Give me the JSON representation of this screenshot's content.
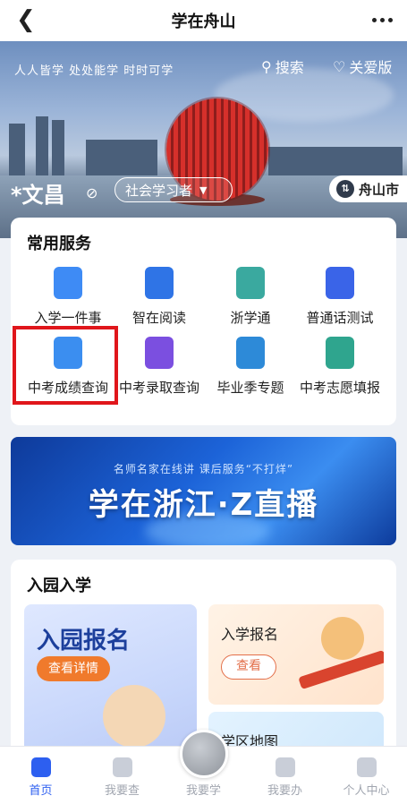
{
  "header": {
    "title": "学在舟山"
  },
  "hero": {
    "slogan": "人人皆学 处处能学 时时可学",
    "search_label": "搜索",
    "care_label": "关爱版",
    "user_name": "*文昌",
    "role": "社会学习者",
    "city": "舟山市"
  },
  "services": {
    "title": "常用服务",
    "items": [
      {
        "label": "入学一件事",
        "icon": "school-enroll-icon",
        "color": "#3e8bf5"
      },
      {
        "label": "智在阅读",
        "icon": "reading-book-icon",
        "color": "#2f74e6"
      },
      {
        "label": "浙学通",
        "icon": "zhexuetong-folder-icon",
        "color": "#3aa99f"
      },
      {
        "label": "普通话测试",
        "icon": "mandarin-test-icon",
        "color": "#3a64e8"
      },
      {
        "label": "中考成绩查询",
        "icon": "score-query-icon",
        "color": "#3b8ef0"
      },
      {
        "label": "中考录取查询",
        "icon": "admission-query-icon",
        "color": "#7b4fe0"
      },
      {
        "label": "毕业季专题",
        "icon": "graduation-cap-icon",
        "color": "#2d8ad8"
      },
      {
        "label": "中考志愿填报",
        "icon": "application-form-icon",
        "color": "#2fa58e"
      }
    ]
  },
  "promo": {
    "subtitle": "名师名家在线讲 课后服务“不打烊”",
    "title": "学在浙江·Z直播"
  },
  "enroll": {
    "title": "入园入学",
    "kindergarten": {
      "title": "入园报名",
      "button": "查看详情"
    },
    "school": {
      "title": "入学报名",
      "button": "查看"
    },
    "district_map": {
      "title": "学区地图"
    }
  },
  "tabbar": {
    "items": [
      {
        "label": "首页"
      },
      {
        "label": "我要查"
      },
      {
        "label": "我要学"
      },
      {
        "label": "我要办"
      },
      {
        "label": "个人中心"
      }
    ]
  }
}
